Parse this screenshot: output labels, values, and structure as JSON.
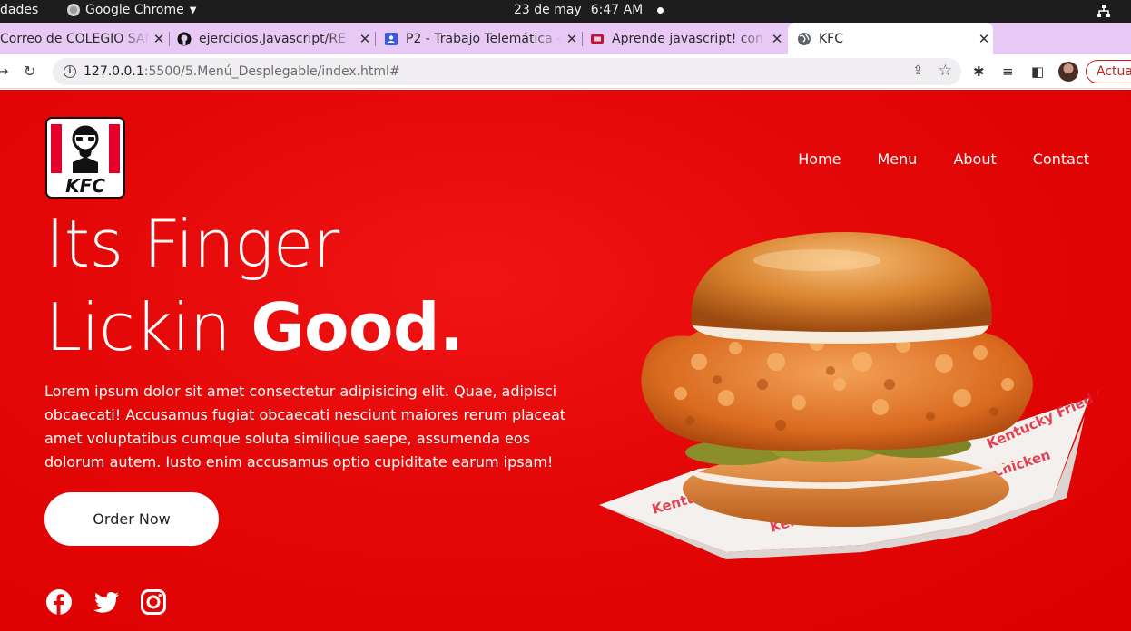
{
  "os": {
    "activities": "dades",
    "app_name": "Google Chrome",
    "date": "23 de may",
    "time": "6:47 AM"
  },
  "tabs": [
    {
      "title": "Correo de COLEGIO SAN"
    },
    {
      "title": "ejercicios.Javascript/RE"
    },
    {
      "title": "P2 - Trabajo Telemática -"
    },
    {
      "title": "Aprende javascript! con"
    },
    {
      "title": "KFC",
      "active": true
    }
  ],
  "browser": {
    "url_host": "127.0.0.1",
    "url_path": ":5500/5.Menú_Desplegable/index.html#",
    "update_label": "Actua"
  },
  "site": {
    "logo_text": "KFC",
    "nav": [
      "Home",
      "Menu",
      "About",
      "Contact"
    ],
    "headline_line1": "Its Finger",
    "headline_line2_light": "Lickin ",
    "headline_line2_bold": "Good.",
    "description": "Lorem ipsum dolor sit amet consectetur adipisicing elit. Quae, adipisci obcaecati! Accusamus fugiat obcaecati nesciunt maiores rerum placeat amet voluptatibus cumque soluta similique saepe, assumenda eos dolorum autem. Iusto enim accusamus optio cupiditate earum ipsam!",
    "cta_label": "Order Now",
    "social": [
      "facebook-icon",
      "twitter-icon",
      "instagram-icon"
    ],
    "wrapper_text": "Kentucky Fried Chicken"
  },
  "colors": {
    "brand_red": "#e30707",
    "tab_strip": "#e8c8f4"
  }
}
